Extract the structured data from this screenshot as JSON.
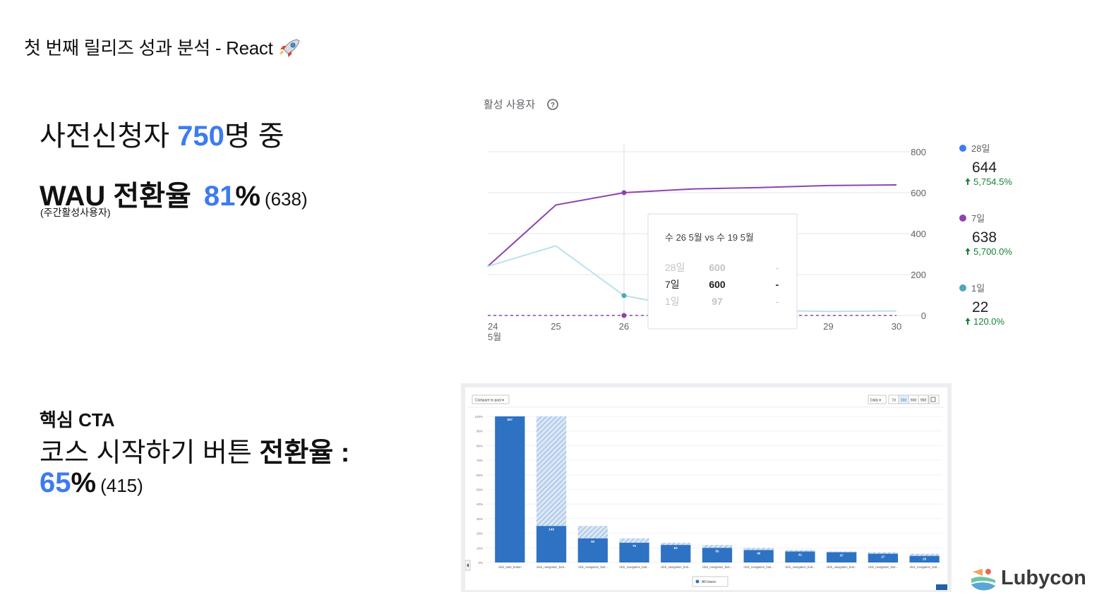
{
  "slide": {
    "title": "첫 번째 릴리즈 성과 분석 - React",
    "title_icon": "rocket-icon"
  },
  "stats": {
    "applicants_prefix": "사전신청자 ",
    "applicants_count": "750",
    "applicants_suffix": "명 중",
    "wau_label": "WAU 전환율",
    "wau_pct_num": "81",
    "wau_pct_sign": "%",
    "wau_count": "(638)",
    "wau_note": "(주간활성사용자)",
    "cta_label": "핵심 CTA",
    "cta_text_prefix": "코스 시작하기 버튼 ",
    "cta_text_bold": "전환율 :",
    "cta_pct_num": "65",
    "cta_pct_sign": "%",
    "cta_count": "(415)"
  },
  "colors": {
    "accent": "#3d7bf0",
    "purple": "#8e44ad",
    "teal": "#4fa8b8",
    "light_teal": "#b9e2ea",
    "bar_blue": "#2e72c4",
    "green": "#188038"
  },
  "brand": {
    "logo_text": "Lubycon",
    "logo_icon": "lubycon-logo-icon"
  },
  "chart_data": [
    {
      "type": "line",
      "title": "활성 사용자",
      "help_icon": "help-circle-icon",
      "x": [
        "24\n5월",
        "25",
        "26",
        "27",
        "28",
        "29",
        "30"
      ],
      "x_ticks": [
        {
          "l1": "24",
          "l2": "5월"
        },
        {
          "l1": "25",
          "l2": ""
        },
        {
          "l1": "26",
          "l2": ""
        },
        {
          "l1": "29",
          "l2": ""
        },
        {
          "l1": "30",
          "l2": ""
        }
      ],
      "x_tick_values": [
        24,
        25,
        26,
        29,
        30
      ],
      "x_domain": [
        24,
        30
      ],
      "ylim": [
        0,
        800
      ],
      "y_ticks": [
        "0",
        "200",
        "400",
        "600",
        "800"
      ],
      "series": [
        {
          "name": "7일",
          "style": "solid",
          "color": "#8e44ad",
          "x": [
            24,
            25,
            26,
            27,
            28,
            29,
            30
          ],
          "y": [
            240,
            540,
            600,
            618,
            625,
            635,
            638
          ]
        },
        {
          "name": "1일",
          "style": "solid",
          "color": "#b9e2ea",
          "x": [
            24,
            25,
            26,
            27,
            28,
            29,
            30
          ],
          "y": [
            240,
            340,
            97,
            35,
            25,
            20,
            22
          ]
        },
        {
          "name": "28일",
          "style": "dashed",
          "color": "#8e44ad",
          "x": [
            24,
            25,
            26
          ],
          "y": [
            0,
            0,
            0
          ]
        }
      ],
      "highlight_x": 26,
      "legend": [
        {
          "name": "28일",
          "value": "644",
          "change": "5,754.5%",
          "color": "#3d7bf0"
        },
        {
          "name": "7일",
          "value": "638",
          "change": "5,700.0%",
          "color": "#8e44ad"
        },
        {
          "name": "1일",
          "value": "22",
          "change": "120.0%",
          "color": "#4fa8b8"
        }
      ],
      "tooltip": {
        "header": "수 26 5월 vs 수 19 5월",
        "rows": [
          {
            "label": "28일",
            "value": "600",
            "prev": "-",
            "state": "faded"
          },
          {
            "label": "7일",
            "value": "600",
            "prev": "-",
            "state": "bold"
          },
          {
            "label": "1일",
            "value": "97",
            "prev": "-",
            "state": "faded"
          }
        ]
      }
    },
    {
      "type": "bar",
      "title": "",
      "controls": {
        "compare": "Compare to past",
        "interval": "Daily",
        "ranges": [
          "7d",
          "30d",
          "60d",
          "90d"
        ]
      },
      "categories": [
        "click_start_button",
        "click_navigation_butt...",
        "click_navigation_butt...",
        "click_navigation_butt...",
        "click_navigation_butt...",
        "click_navigation_butt...",
        "click_navigation_butt...",
        "click_navigation_butt...",
        "click_navigation_butt...",
        "click_navigation_butt...",
        "click_navigation_butt..."
      ],
      "y_ticks": [
        "0%",
        "10%",
        "20%",
        "30%",
        "40%",
        "50%",
        "60%",
        "70%",
        "80%",
        "90%",
        "100%"
      ],
      "ylim": [
        0,
        100
      ],
      "series": [
        {
          "name": "All Users",
          "values": [
            100,
            25,
            16.5,
            13.5,
            12,
            10,
            8.5,
            7.5,
            7,
            6,
            4.5
          ],
          "labels": [
            "557",
            "140",
            "93",
            "75",
            "63",
            "55",
            "46",
            "41",
            "37",
            "27",
            "20"
          ],
          "dropoff": [
            0,
            75,
            8.5,
            3,
            1.5,
            2,
            1.5,
            1,
            0.5,
            1,
            1.5
          ]
        }
      ],
      "legend": [
        "All Users"
      ]
    }
  ]
}
